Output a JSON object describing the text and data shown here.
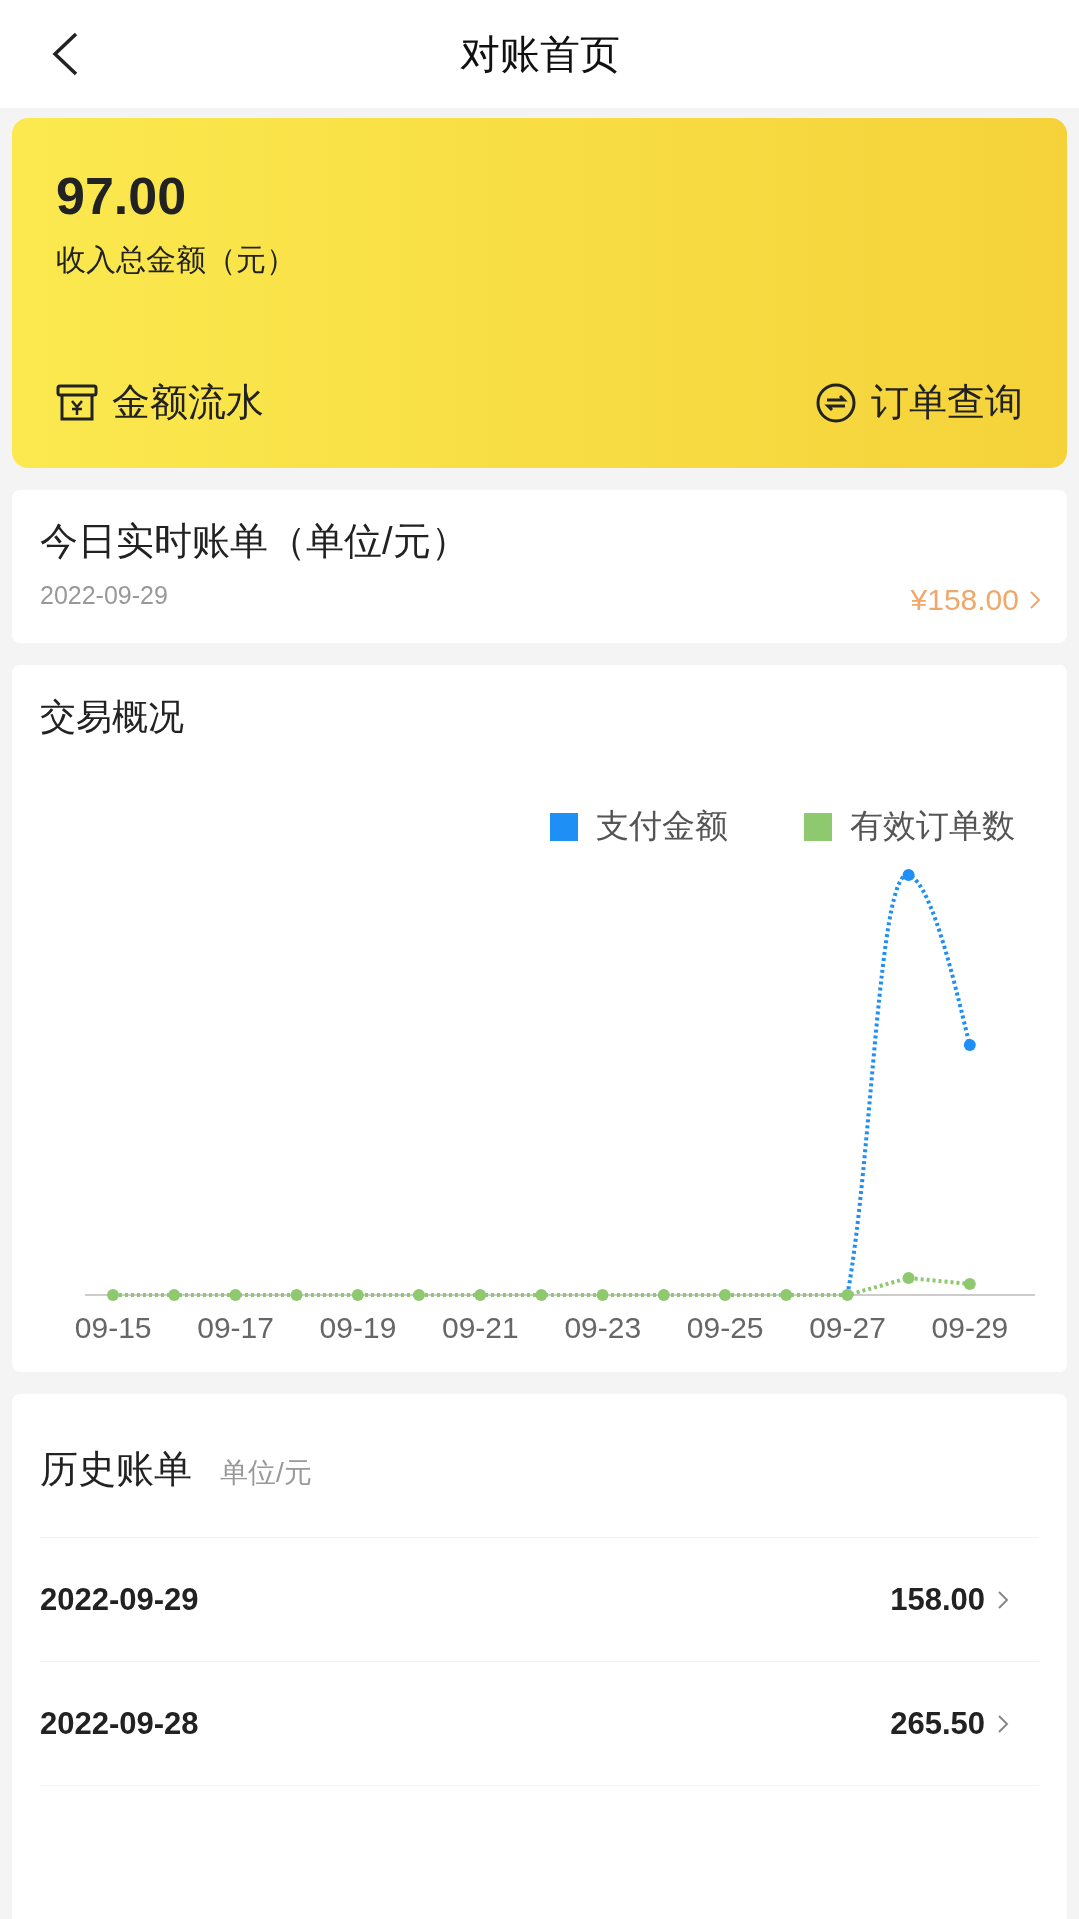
{
  "header": {
    "title": "对账首页"
  },
  "summary": {
    "amount": "97.00",
    "label": "收入总金额（元）",
    "actions": [
      {
        "kind": "ledger",
        "label": "金额流水"
      },
      {
        "kind": "orders",
        "label": "订单查询"
      }
    ]
  },
  "today": {
    "title": "今日实时账单（单位/元）",
    "date": "2022-09-29",
    "amount": "¥158.00"
  },
  "chart": {
    "title": "交易概况",
    "legend": [
      {
        "name": "支付金额",
        "color": "#1e8ff5"
      },
      {
        "name": "有效订单数",
        "color": "#8ec96f"
      }
    ],
    "x_labels": [
      "09-15",
      "09-17",
      "09-19",
      "09-21",
      "09-23",
      "09-25",
      "09-27",
      "09-29"
    ]
  },
  "history": {
    "title": "历史账单",
    "unit": "单位/元",
    "rows": [
      {
        "date": "2022-09-29",
        "amount": "158.00"
      },
      {
        "date": "2022-09-28",
        "amount": "265.50"
      }
    ]
  }
}
